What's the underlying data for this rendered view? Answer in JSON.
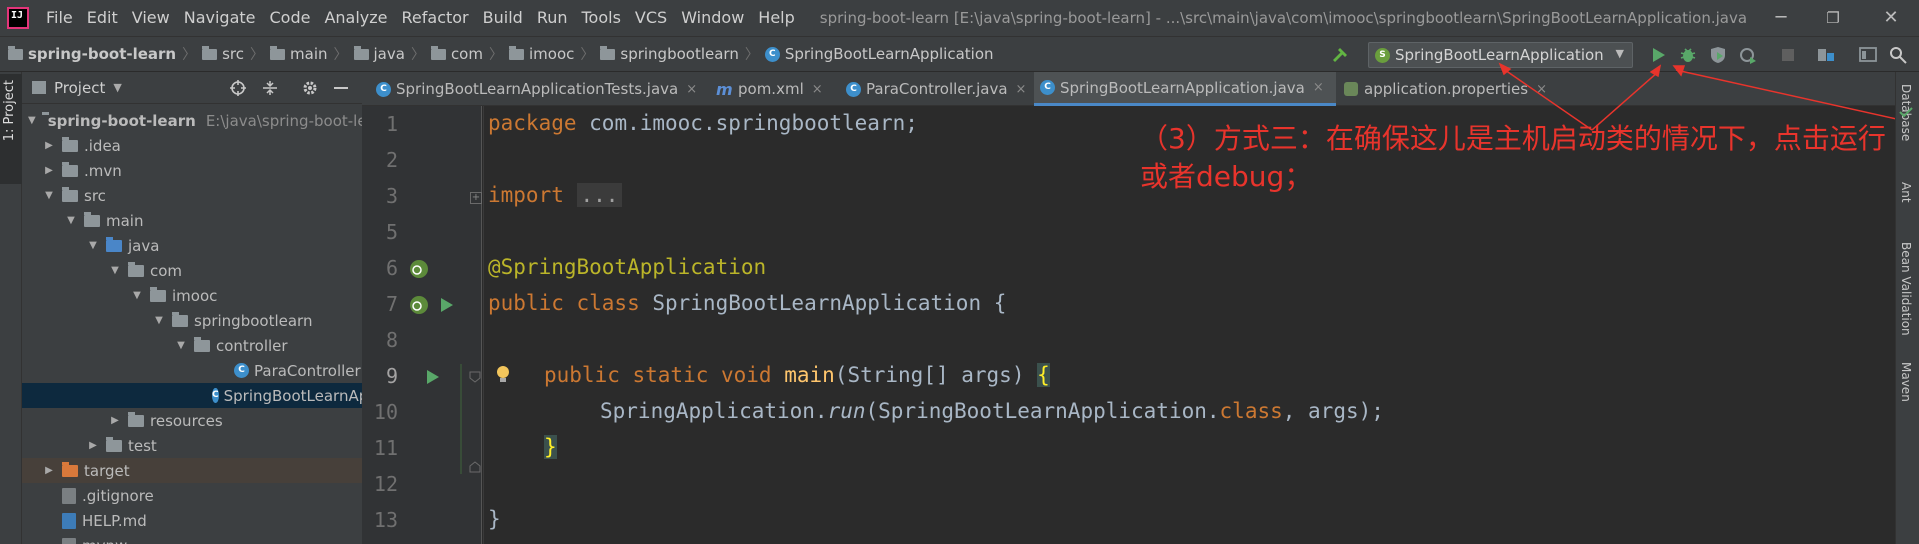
{
  "window": {
    "title": "spring-boot-learn [E:\\java\\spring-boot-learn] - ...\\src\\main\\java\\com\\imooc\\springbootlearn\\SpringBootLearnApplication.java",
    "minimize": "─",
    "maximize": "❐",
    "close": "✕"
  },
  "menu": [
    "File",
    "Edit",
    "View",
    "Navigate",
    "Code",
    "Analyze",
    "Refactor",
    "Build",
    "Run",
    "Tools",
    "VCS",
    "Window",
    "Help"
  ],
  "breadcrumb": [
    "spring-boot-learn",
    "src",
    "main",
    "java",
    "com",
    "imooc",
    "springbootlearn",
    "SpringBootLearnApplication"
  ],
  "run_config": {
    "label": "SpringBootLearnApplication"
  },
  "project_panel": {
    "title": "Project",
    "tree": [
      {
        "label": "spring-boot-learn",
        "extra": "E:\\java\\spring-boot-learn"
      },
      {
        "label": ".idea"
      },
      {
        "label": ".mvn"
      },
      {
        "label": "src"
      },
      {
        "label": "main"
      },
      {
        "label": "java"
      },
      {
        "label": "com"
      },
      {
        "label": "imooc"
      },
      {
        "label": "springbootlearn"
      },
      {
        "label": "controller"
      },
      {
        "label": "ParaController"
      },
      {
        "label": "SpringBootLearnApplication"
      },
      {
        "label": "resources"
      },
      {
        "label": "test"
      },
      {
        "label": "target"
      },
      {
        "label": ".gitignore"
      },
      {
        "label": "HELP.md"
      },
      {
        "label": "mvnw"
      }
    ]
  },
  "tabs": [
    {
      "label": "SpringBootLearnApplicationTests.java",
      "close": "×"
    },
    {
      "label": "pom.xml",
      "close": "×"
    },
    {
      "label": "ParaController.java",
      "close": "×"
    },
    {
      "label": "SpringBootLearnApplication.java",
      "close": "×"
    },
    {
      "label": "application.properties",
      "close": "×"
    }
  ],
  "editor": {
    "line_numbers": [
      "1",
      "2",
      "3",
      "5",
      "6",
      "7",
      "8",
      "9",
      "10",
      "11",
      "12",
      "13"
    ],
    "code": {
      "l1_kw": "package",
      "l1_rest": " com.imooc.springbootlearn;",
      "l3_kw": "import",
      "l3_fold": "...",
      "l6_ann": "@SpringBootApplication",
      "l7_kw": "public class",
      "l7_rest": " SpringBootLearnApplication {",
      "l9_kw": "public static void",
      "l9_fn": "main",
      "l9_rest": "(String[] args) ",
      "l9_brace": "{",
      "l10_a": "SpringApplication.",
      "l10_run": "run",
      "l10_b": "(SpringBootLearnApplication.",
      "l10_kw": "class",
      "l10_c": ", args);",
      "l11": "}",
      "l13": "}"
    }
  },
  "annotation": {
    "text": "（3）方式三：在确保这儿是主机启动类的情况下，点击运行或者debug；",
    "color": "#e8342c"
  },
  "right_strip": [
    "Database",
    "Ant",
    "Bean Validation",
    "Maven"
  ],
  "left_strip": {
    "project_tab": "1: Project"
  }
}
